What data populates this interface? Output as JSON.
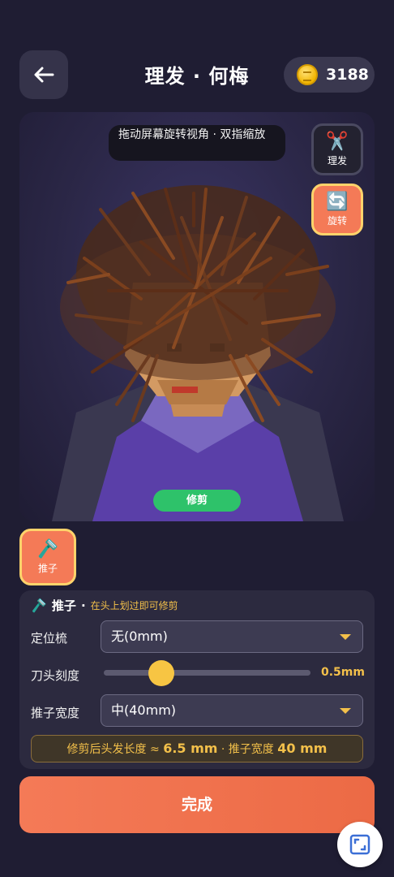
{
  "header": {
    "back_icon": "arrow-left-icon",
    "title": "理发 · 何梅",
    "coins": "3188",
    "coin_icon": "coin-icon"
  },
  "viewport": {
    "hint": "拖动屏幕旋转视角 · 双指缩放",
    "tools": [
      {
        "icon": "scissors-icon",
        "label": "理发",
        "active": false
      },
      {
        "icon": "rotate-icon",
        "label": "旋转",
        "active": true
      }
    ],
    "mode_pill": "修剪"
  },
  "tool_selector": {
    "icon": "clipper-icon",
    "label": "推子"
  },
  "panel": {
    "tool_name": "推子",
    "separator": "·",
    "tip": "在头上划过即可修剪",
    "guide_comb": {
      "label": "定位梳",
      "value": "无(0mm)"
    },
    "blade_setting": {
      "label": "刀头刻度",
      "value": "0.5mm",
      "fraction": 0.28
    },
    "clipper_width": {
      "label": "推子宽度",
      "value": "中(40mm)"
    },
    "summary": {
      "prefix": "修剪后头发长度 ≈ ",
      "length": "6.5 mm",
      "middle": " · 推子宽度 ",
      "width": "40 mm"
    }
  },
  "done_button": "完成",
  "corner_icon": "crop-frame-icon",
  "colors": {
    "accent": "#f47a57",
    "highlight": "#f3c04a",
    "trim_green": "#2ec26a",
    "background": "#1f1d33"
  }
}
